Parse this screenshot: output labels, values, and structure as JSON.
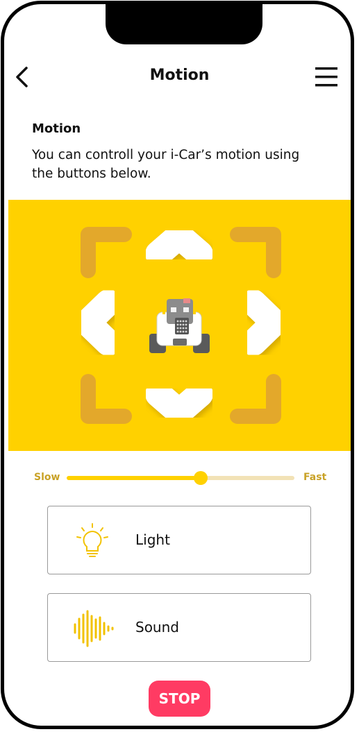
{
  "header": {
    "title": "Motion"
  },
  "section": {
    "title": "Motion",
    "description": "You can controll your i-Car’s motion using the buttons below."
  },
  "pad": {
    "background": "#ffd100",
    "buttons": [
      "up-arrow-icon",
      "down-arrow-icon",
      "left-arrow-icon",
      "right-arrow-icon"
    ]
  },
  "speed": {
    "min_label": "Slow",
    "max_label": "Fast",
    "value": 0.59
  },
  "cards": [
    {
      "label": "Light",
      "icon": "lightbulb-icon"
    },
    {
      "label": "Sound",
      "icon": "sound-wave-icon"
    }
  ],
  "stop": {
    "label": "STOP",
    "color": "#ff3b63"
  }
}
